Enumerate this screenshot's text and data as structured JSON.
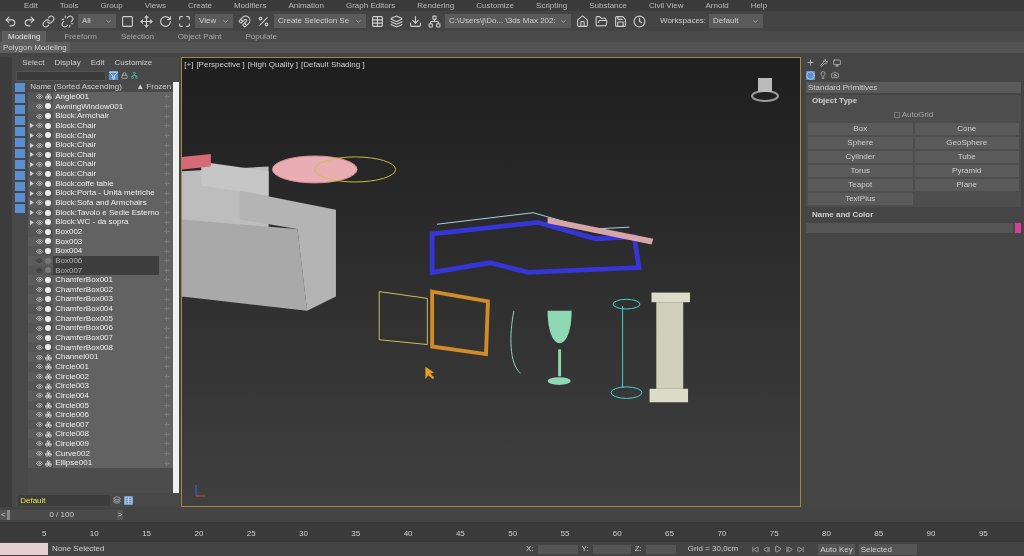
{
  "menu_bar": [
    "Edit",
    "Tools",
    "Group",
    "Views",
    "Create",
    "Modifiers",
    "Animation",
    "Graph Editors",
    "Rendering",
    "Customize",
    "Scripting",
    "Substance",
    "Civil View",
    "Arnold",
    "Help"
  ],
  "main_toolbar": {
    "selection_filter": "All",
    "reference_coord": "View",
    "selection_set": "Create Selection Se",
    "project_path": "C:\\Users\\j\\Do... \\3ds Max 202:",
    "workspaces_label": "Workspaces:",
    "workspace": "Default"
  },
  "ribbon_tabs": [
    {
      "label": "Modeling",
      "selected": true
    },
    {
      "label": "Freeform",
      "selected": false
    },
    {
      "label": "Selection",
      "selected": false
    },
    {
      "label": "Object Paint",
      "selected": false
    },
    {
      "label": "Populate",
      "selected": false
    }
  ],
  "ribbon_panel": "Polygon Modeling",
  "scene_explorer": {
    "menus": [
      "Select",
      "Display",
      "Edit",
      "Customize"
    ],
    "columns": [
      "Name (Sorted Ascending)",
      "▲ Frozen"
    ],
    "rows": [
      {
        "name": "Angle001",
        "kind": "shape",
        "expandable": false,
        "hidden": false
      },
      {
        "name": "AwningWindow001",
        "kind": "geometry",
        "expandable": false,
        "hidden": false
      },
      {
        "name": "Block:Armchair",
        "kind": "geometry",
        "expandable": false,
        "hidden": false
      },
      {
        "name": "Block:Chair",
        "kind": "geometry",
        "expandable": true,
        "hidden": false
      },
      {
        "name": "Block:Chair",
        "kind": "geometry",
        "expandable": true,
        "hidden": false
      },
      {
        "name": "Block:Chair",
        "kind": "geometry",
        "expandable": true,
        "hidden": false
      },
      {
        "name": "Block:Chair",
        "kind": "geometry",
        "expandable": true,
        "hidden": false
      },
      {
        "name": "Block:Chair",
        "kind": "geometry",
        "expandable": true,
        "hidden": false
      },
      {
        "name": "Block:Chair",
        "kind": "geometry",
        "expandable": true,
        "hidden": false
      },
      {
        "name": "Block:coffe table",
        "kind": "geometry",
        "expandable": true,
        "hidden": false
      },
      {
        "name": "Block:Porta - Unità metriche",
        "kind": "geometry",
        "expandable": true,
        "hidden": false
      },
      {
        "name": "Block:Sofa and Armchairs",
        "kind": "geometry",
        "expandable": true,
        "hidden": false
      },
      {
        "name": "Block:Tavolo e Sedie Esterno",
        "kind": "geometry",
        "expandable": true,
        "hidden": false
      },
      {
        "name": "Block:WC - da sopra",
        "kind": "geometry",
        "expandable": true,
        "hidden": false
      },
      {
        "name": "Box002",
        "kind": "geometry",
        "expandable": false,
        "hidden": false
      },
      {
        "name": "Box003",
        "kind": "geometry",
        "expandable": false,
        "hidden": false
      },
      {
        "name": "Box004",
        "kind": "geometry",
        "expandable": false,
        "hidden": false
      },
      {
        "name": "Box006",
        "kind": "geometry",
        "expandable": false,
        "hidden": true
      },
      {
        "name": "Box007",
        "kind": "geometry",
        "expandable": false,
        "hidden": true
      },
      {
        "name": "ChamferBox001",
        "kind": "geometry",
        "expandable": false,
        "hidden": false
      },
      {
        "name": "ChamferBox002",
        "kind": "geometry",
        "expandable": false,
        "hidden": false
      },
      {
        "name": "ChamferBox003",
        "kind": "geometry",
        "expandable": false,
        "hidden": false
      },
      {
        "name": "ChamferBox004",
        "kind": "geometry",
        "expandable": false,
        "hidden": false
      },
      {
        "name": "ChamferBox005",
        "kind": "geometry",
        "expandable": false,
        "hidden": false
      },
      {
        "name": "ChamferBox006",
        "kind": "geometry",
        "expandable": false,
        "hidden": false
      },
      {
        "name": "ChamferBox007",
        "kind": "geometry",
        "expandable": false,
        "hidden": false
      },
      {
        "name": "ChamferBox008",
        "kind": "geometry",
        "expandable": false,
        "hidden": false
      },
      {
        "name": "Channel001",
        "kind": "shape",
        "expandable": false,
        "hidden": false
      },
      {
        "name": "Circle001",
        "kind": "shape",
        "expandable": false,
        "hidden": false
      },
      {
        "name": "Circle002",
        "kind": "shape",
        "expandable": false,
        "hidden": false
      },
      {
        "name": "Circle003",
        "kind": "shape",
        "expandable": false,
        "hidden": false
      },
      {
        "name": "Circle004",
        "kind": "shape",
        "expandable": false,
        "hidden": false
      },
      {
        "name": "Circle005",
        "kind": "shape",
        "expandable": false,
        "hidden": false
      },
      {
        "name": "Circle006",
        "kind": "shape",
        "expandable": false,
        "hidden": false
      },
      {
        "name": "Circle007",
        "kind": "shape",
        "expandable": false,
        "hidden": false
      },
      {
        "name": "Circle008",
        "kind": "shape",
        "expandable": false,
        "hidden": false
      },
      {
        "name": "Circle009",
        "kind": "shape",
        "expandable": false,
        "hidden": false
      },
      {
        "name": "Curve002",
        "kind": "shape",
        "expandable": false,
        "hidden": false
      },
      {
        "name": "Ellipse001",
        "kind": "shape",
        "expandable": false,
        "hidden": false
      }
    ],
    "layer": "Default"
  },
  "viewport": {
    "labels": [
      "[+]",
      "[Perspective ]",
      "[High Quality ]",
      "[Default Shading ]"
    ]
  },
  "command_panel": {
    "dropdown": "Standard Primitives",
    "object_type": {
      "title": "Object Type",
      "autogrid": {
        "label": "AutoGrid",
        "checked": false,
        "disabled": true
      },
      "buttons": [
        "Box",
        "Cone",
        "Sphere",
        "GeoSphere",
        "Cylinder",
        "Tube",
        "Torus",
        "Pyramid",
        "Teapot",
        "Plane",
        "TextPlus"
      ]
    },
    "name_and_color": {
      "title": "Name and Color",
      "color": "#d63d9c"
    }
  },
  "time_slider": {
    "reading": "0 / 100",
    "level": 0,
    "prev": "<",
    "next": ">"
  },
  "track_bar": {
    "ticks": [
      "5",
      "10",
      "15",
      "20",
      "25",
      "30",
      "35",
      "40",
      "45",
      "50",
      "55",
      "60",
      "65",
      "70",
      "75",
      "80",
      "85",
      "90",
      "95"
    ]
  },
  "status_bar": {
    "selection": "None Selected",
    "x_label": "X:",
    "y_label": "Y:",
    "z_label": "Z:",
    "grid": "Grid = 30,0cm",
    "auto_key": "Auto Key",
    "key_filter": "Selected"
  }
}
